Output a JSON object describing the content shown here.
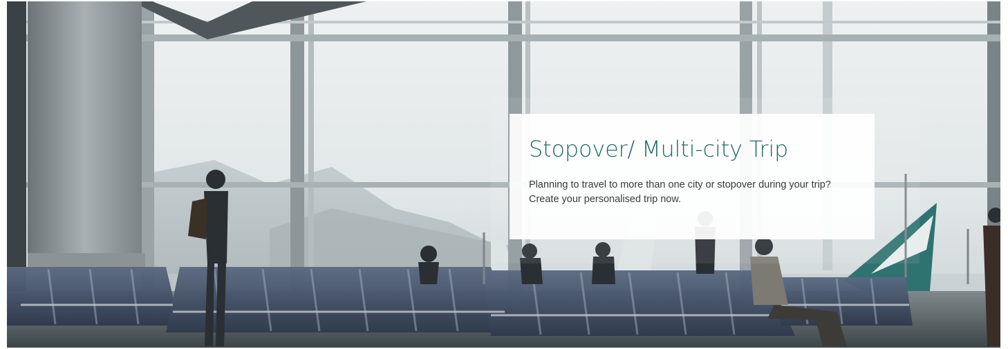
{
  "hero": {
    "image_icon": "airport-lounge-photo",
    "card": {
      "title": "Stopover/ Multi-city Trip",
      "description": "Planning to travel to more than one city or stopover during your trip? Create your personalised trip now."
    }
  },
  "colors": {
    "title": "#1e6a66",
    "body_text": "#3a3a3a",
    "card_background": "#ffffff"
  }
}
